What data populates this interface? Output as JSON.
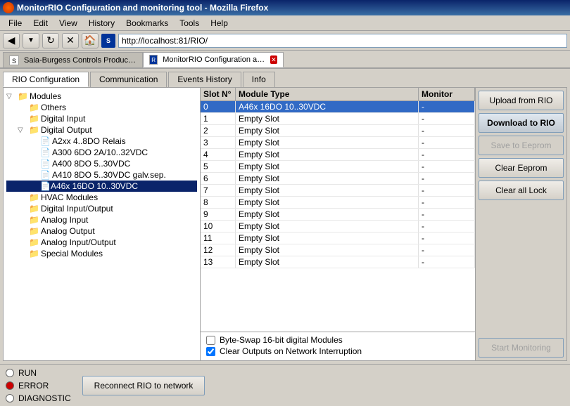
{
  "window": {
    "title": "MonitorRIO Configuration and monitoring tool - Mozilla Firefox"
  },
  "menubar": {
    "items": [
      "File",
      "Edit",
      "View",
      "History",
      "Bookmarks",
      "Tools",
      "Help"
    ]
  },
  "addressbar": {
    "url": "http://localhost:81/RIO/"
  },
  "browser_tabs": [
    {
      "id": "saia",
      "label": "Saia-Burgess Controls Product Support ...",
      "active": false,
      "closable": false
    },
    {
      "id": "monitor",
      "label": "MonitorRIO Configuration and mo...",
      "active": true,
      "closable": true
    }
  ],
  "app_tabs": [
    {
      "id": "rio-config",
      "label": "RIO Configuration",
      "active": true
    },
    {
      "id": "communication",
      "label": "Communication",
      "active": false
    },
    {
      "id": "events-history",
      "label": "Events History",
      "active": false
    },
    {
      "id": "info",
      "label": "Info",
      "active": false
    }
  ],
  "tree": {
    "root_label": "Modules",
    "items": [
      {
        "id": "others",
        "label": "Others",
        "indent": 1,
        "has_children": false
      },
      {
        "id": "digital-input",
        "label": "Digital Input",
        "indent": 1,
        "has_children": false
      },
      {
        "id": "digital-output",
        "label": "Digital Output",
        "indent": 1,
        "has_children": true,
        "expanded": true
      },
      {
        "id": "a2xx-4-8do",
        "label": "A2xx 4..8DO Relais",
        "indent": 2,
        "has_children": false
      },
      {
        "id": "a300-6do",
        "label": "A300 6DO 2A/10..32VDC",
        "indent": 2,
        "has_children": false
      },
      {
        "id": "a400-8do",
        "label": "A400 8DO 5..30VDC",
        "indent": 2,
        "has_children": false
      },
      {
        "id": "a410-8do",
        "label": "A410 8DO 5..30VDC galv.sep.",
        "indent": 2,
        "has_children": false
      },
      {
        "id": "a46x-16do",
        "label": "A46x 16DO 10..30VDC",
        "indent": 2,
        "has_children": false,
        "selected": true
      },
      {
        "id": "hvac-modules",
        "label": "HVAC Modules",
        "indent": 1,
        "has_children": false
      },
      {
        "id": "digital-io",
        "label": "Digital Input/Output",
        "indent": 1,
        "has_children": false
      },
      {
        "id": "analog-input",
        "label": "Analog Input",
        "indent": 1,
        "has_children": false
      },
      {
        "id": "analog-output",
        "label": "Analog Output",
        "indent": 1,
        "has_children": false
      },
      {
        "id": "analog-io",
        "label": "Analog Input/Output",
        "indent": 1,
        "has_children": false
      },
      {
        "id": "special-modules",
        "label": "Special Modules",
        "indent": 1,
        "has_children": false
      }
    ]
  },
  "grid": {
    "columns": [
      "Slot N°",
      "Module Type",
      "Monitor"
    ],
    "rows": [
      {
        "slot": "0",
        "type": "A46x 16DO 10..30VDC",
        "monitor": "-",
        "selected": true
      },
      {
        "slot": "1",
        "type": "Empty Slot",
        "monitor": "-",
        "selected": false
      },
      {
        "slot": "2",
        "type": "Empty Slot",
        "monitor": "-",
        "selected": false
      },
      {
        "slot": "3",
        "type": "Empty Slot",
        "monitor": "-",
        "selected": false
      },
      {
        "slot": "4",
        "type": "Empty Slot",
        "monitor": "-",
        "selected": false
      },
      {
        "slot": "5",
        "type": "Empty Slot",
        "monitor": "-",
        "selected": false
      },
      {
        "slot": "6",
        "type": "Empty Slot",
        "monitor": "-",
        "selected": false
      },
      {
        "slot": "7",
        "type": "Empty Slot",
        "monitor": "-",
        "selected": false
      },
      {
        "slot": "8",
        "type": "Empty Slot",
        "monitor": "-",
        "selected": false
      },
      {
        "slot": "9",
        "type": "Empty Slot",
        "monitor": "-",
        "selected": false
      },
      {
        "slot": "10",
        "type": "Empty Slot",
        "monitor": "-",
        "selected": false
      },
      {
        "slot": "11",
        "type": "Empty Slot",
        "monitor": "-",
        "selected": false
      },
      {
        "slot": "12",
        "type": "Empty Slot",
        "monitor": "-",
        "selected": false
      },
      {
        "slot": "13",
        "type": "Empty Slot",
        "monitor": "-",
        "selected": false
      }
    ]
  },
  "options": {
    "byte_swap_label": "Byte-Swap 16-bit digital Modules",
    "byte_swap_checked": false,
    "clear_outputs_label": "Clear Outputs on Network Interruption",
    "clear_outputs_checked": true
  },
  "side_buttons": {
    "upload": "Upload from RIO",
    "download": "Download to RIO",
    "save_eeprom": "Save to Eeprom",
    "clear_eeprom": "Clear Eeprom",
    "clear_lock": "Clear all Lock",
    "start_monitoring": "Start Monitoring"
  },
  "status": {
    "run_label": "RUN",
    "error_label": "ERROR",
    "diagnostic_label": "DIAGNOSTIC",
    "reconnect_label": "Reconnect RIO to network"
  }
}
